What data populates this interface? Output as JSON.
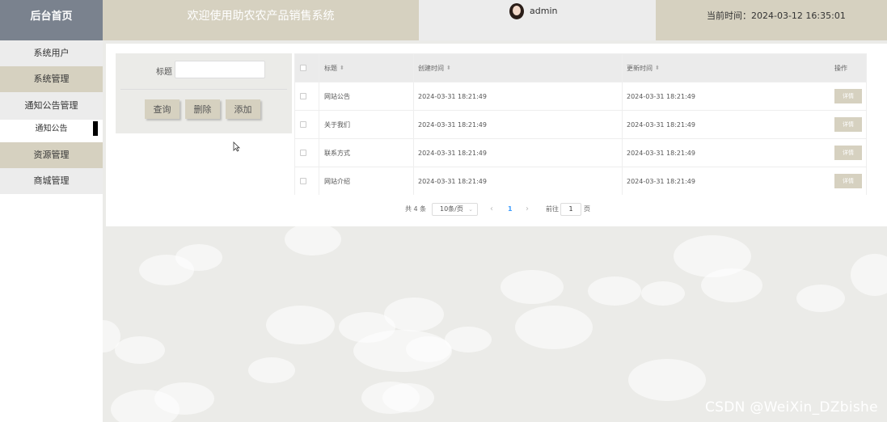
{
  "header": {
    "home_label": "后台首页",
    "welcome": "欢迎使用助农农产品销售系统",
    "username": "admin",
    "current_time": "当前时间：2024-03-12 16:35:01"
  },
  "sidebar": {
    "items": [
      {
        "label": "系统用户"
      },
      {
        "label": "系统管理"
      },
      {
        "label": "通知公告管理"
      },
      {
        "label": "通知公告"
      },
      {
        "label": "资源管理"
      },
      {
        "label": "商城管理"
      }
    ]
  },
  "search": {
    "title_label": "标题",
    "title_value": "",
    "query_button": "查询",
    "delete_button": "删除",
    "add_button": "添加"
  },
  "table": {
    "columns": [
      "标题",
      "创建时间",
      "更新时间",
      "操作"
    ],
    "sort_icon": "sort-caret-icon",
    "rows": [
      {
        "title": "网站公告",
        "created": "2024-03-31 18:21:49",
        "updated": "2024-03-31 18:21:49",
        "action": "详情"
      },
      {
        "title": "关于我们",
        "created": "2024-03-31 18:21:49",
        "updated": "2024-03-31 18:21:49",
        "action": "详情"
      },
      {
        "title": "联系方式",
        "created": "2024-03-31 18:21:49",
        "updated": "2024-03-31 18:21:49",
        "action": "详情"
      },
      {
        "title": "网站介绍",
        "created": "2024-03-31 18:21:49",
        "updated": "2024-03-31 18:21:49",
        "action": "详情"
      }
    ]
  },
  "pagination": {
    "total": "共 4 条",
    "page_size": "10条/页",
    "prev": "‹",
    "current_page": "1",
    "next": "›",
    "goto_label": "前往",
    "goto_value": "1",
    "page_suffix": "页"
  },
  "watermark": "CSDN @WeiXin_DZbishe",
  "colors": {
    "accent": "#d6d1c0",
    "home_bg": "#7a828e",
    "user_bg": "#ececec",
    "link": "#409eff"
  }
}
